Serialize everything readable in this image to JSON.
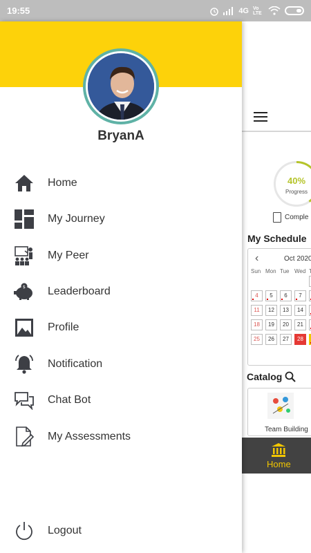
{
  "status_bar": {
    "time": "19:55",
    "network": "4G",
    "volte": "Vo LTE"
  },
  "drawer": {
    "username": "BryanA",
    "menu": [
      {
        "label": "Home",
        "icon": "home-icon"
      },
      {
        "label": "My Journey",
        "icon": "dashboard-icon"
      },
      {
        "label": "My Peer",
        "icon": "teacher-icon"
      },
      {
        "label": "Leaderboard",
        "icon": "piggy-bank-icon"
      },
      {
        "label": "Profile",
        "icon": "image-icon"
      },
      {
        "label": "Notification",
        "icon": "bell-icon"
      },
      {
        "label": "Chat Bot",
        "icon": "chat-icon"
      },
      {
        "label": "My Assessments",
        "icon": "document-edit-icon"
      }
    ],
    "logout_label": "Logout"
  },
  "background": {
    "progress": {
      "value": "40%",
      "label": "Progress",
      "fraction": 0.4
    },
    "complete_label": "Comple",
    "schedule_title": "My Schedule",
    "calendar": {
      "month": "Oct 2020",
      "weekdays": [
        "Sun",
        "Mon",
        "Tue",
        "Wed",
        "T"
      ],
      "rows": [
        [
          "4",
          "5",
          "6",
          "7",
          ""
        ],
        [
          "11",
          "12",
          "13",
          "14",
          ""
        ],
        [
          "18",
          "19",
          "20",
          "21",
          ""
        ],
        [
          "25",
          "26",
          "27",
          "28",
          ""
        ]
      ]
    },
    "catalog_title": "Catalog",
    "catalog_item": "Team Building",
    "bottom_nav_label": "Home",
    "colors": {
      "accent": "#fdd20a",
      "nav_bg": "#424242",
      "today": "#e53935",
      "progress": "#b5c42a"
    }
  }
}
